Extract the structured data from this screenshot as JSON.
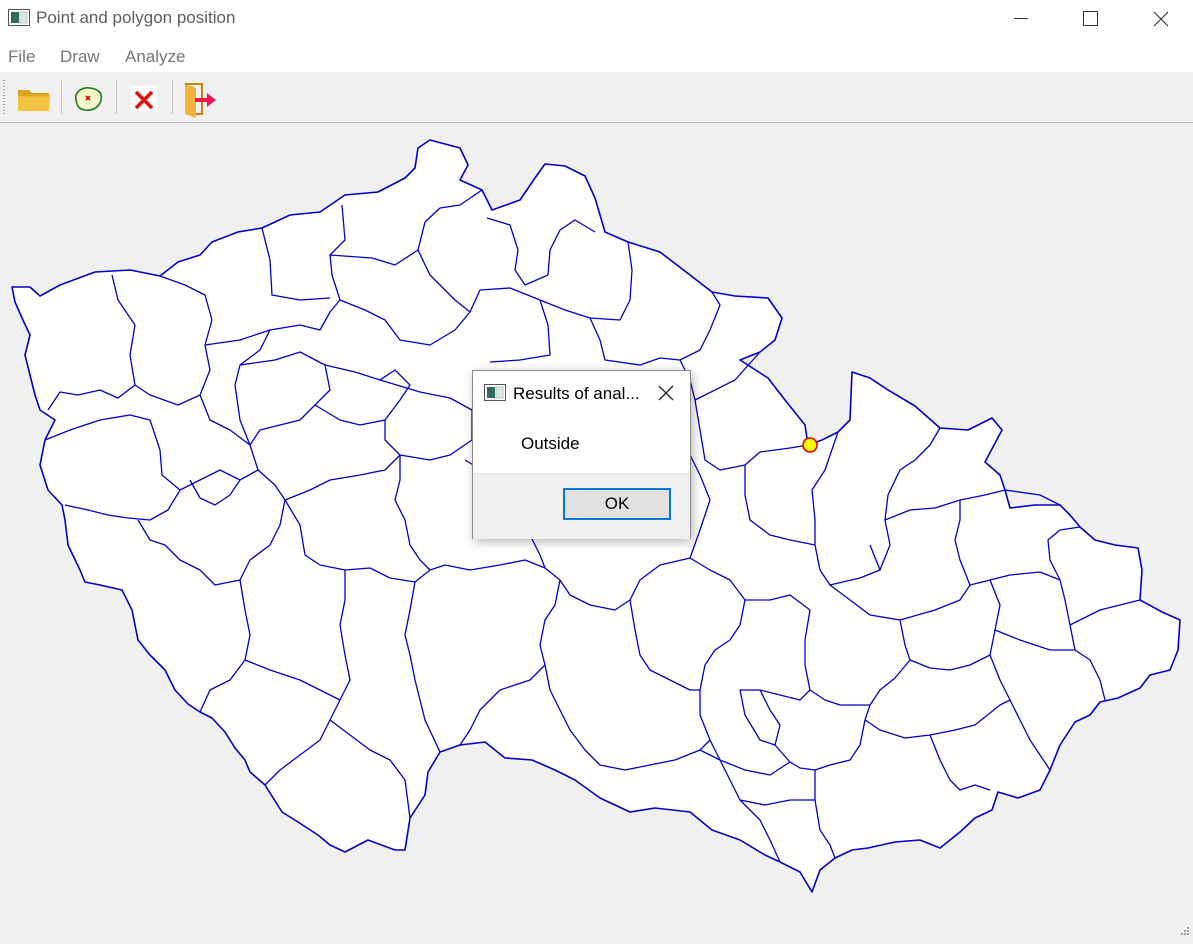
{
  "window": {
    "title": "Point and polygon position",
    "controls": [
      "minimize",
      "maximize",
      "close"
    ]
  },
  "menu": {
    "file": "File",
    "draw": "Draw",
    "analyze": "Analyze"
  },
  "toolbar": {
    "buttons": [
      {
        "name": "open-folder-icon"
      },
      {
        "name": "polygon-point-icon"
      },
      {
        "name": "clear-x-icon"
      },
      {
        "name": "exit-door-icon"
      }
    ]
  },
  "map": {
    "polygon_stroke": "#0000c8",
    "polygon_fill": "#ffffff",
    "point_fill": "#ffff00",
    "point_stroke": "#d40000"
  },
  "dialog": {
    "title": "Results of anal...",
    "message": "Outside",
    "ok_label": "OK"
  }
}
